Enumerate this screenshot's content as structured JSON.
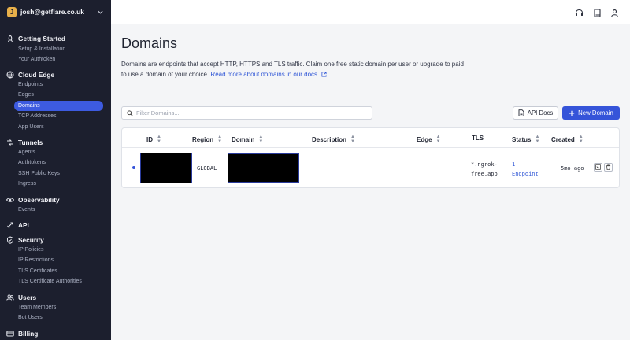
{
  "account": {
    "initial": "J",
    "email": "josh@getflare.co.uk"
  },
  "sidebar": {
    "sections": [
      {
        "title": "Getting Started",
        "icon": "rocket-icon",
        "items": [
          "Setup & Installation",
          "Your Authtoken"
        ]
      },
      {
        "title": "Cloud Edge",
        "icon": "globe-icon",
        "items": [
          "Endpoints",
          "Edges",
          "Domains",
          "TCP Addresses",
          "App Users"
        ]
      },
      {
        "title": "Tunnels",
        "icon": "tunnel-icon",
        "items": [
          "Agents",
          "Authtokens",
          "SSH Public Keys",
          "Ingress"
        ]
      },
      {
        "title": "Observability",
        "icon": "eye-icon",
        "items": [
          "Events"
        ]
      },
      {
        "title": "API",
        "icon": "api-icon",
        "items": []
      },
      {
        "title": "Security",
        "icon": "shield-icon",
        "items": [
          "IP Policies",
          "IP Restrictions",
          "TLS Certificates",
          "TLS Certificate Authorities"
        ]
      },
      {
        "title": "Users",
        "icon": "users-icon",
        "items": [
          "Team Members",
          "Bot Users"
        ]
      },
      {
        "title": "Billing",
        "icon": "billing-icon",
        "items": []
      }
    ],
    "active_item": "Domains"
  },
  "topbar": {
    "icons": [
      "headset-icon",
      "book-icon",
      "user-icon"
    ]
  },
  "page": {
    "title": "Domains",
    "description": "Domains are endpoints that accept HTTP, HTTPS and TLS traffic. Claim one free static domain per user or upgrade to paid to use a domain of your choice.",
    "docs_link": "Read more about domains in our docs."
  },
  "filter": {
    "placeholder": "Filter Domains..."
  },
  "buttons": {
    "api_docs": "API Docs",
    "new_domain": "New Domain"
  },
  "table": {
    "columns": [
      "ID",
      "Region",
      "Domain",
      "Description",
      "Edge",
      "TLS",
      "Status",
      "Created"
    ],
    "rows": [
      {
        "id": "",
        "region": "GLOBAL",
        "domain": "",
        "description": "",
        "edge": "",
        "tls": "*.ngrok-free.app",
        "status": "1 Endpoint",
        "created": "5mo ago"
      }
    ]
  },
  "colors": {
    "sidebar_bg": "#1c1f2e",
    "accent": "#3554d9",
    "link": "#2f56d6"
  }
}
